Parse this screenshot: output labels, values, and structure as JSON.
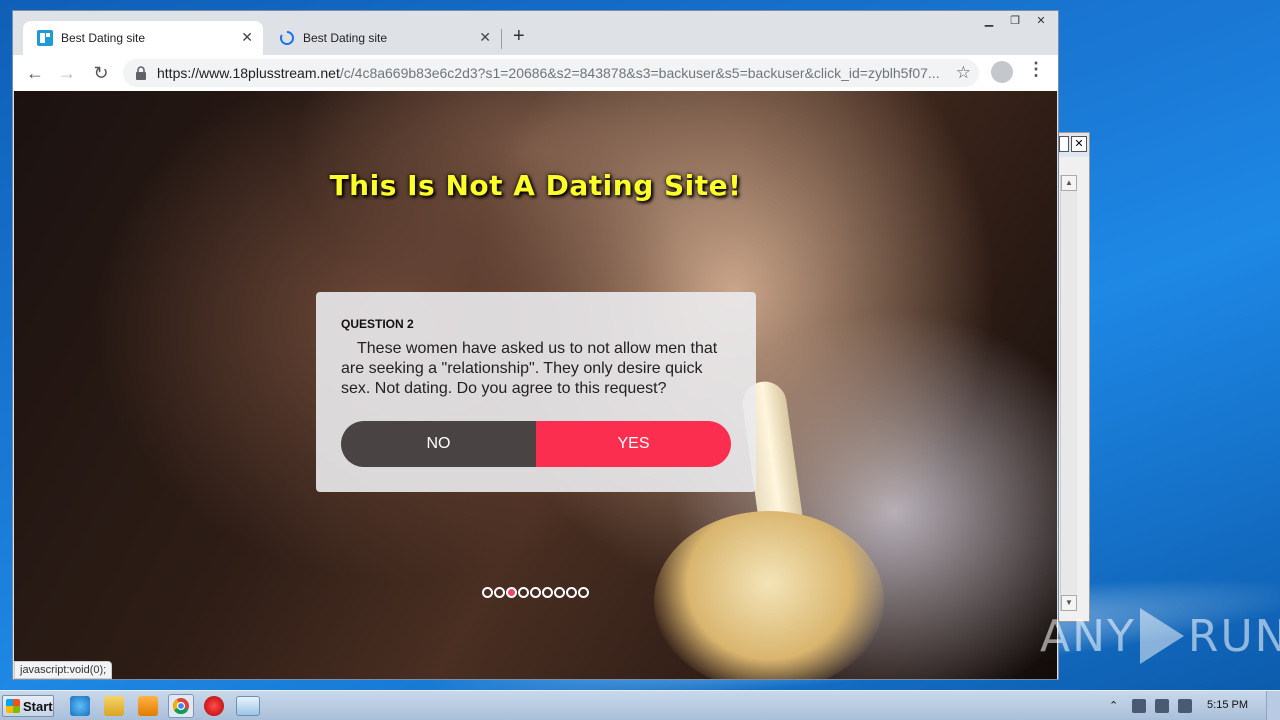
{
  "browser": {
    "tabs": [
      {
        "label": "Best Dating site",
        "active": true
      },
      {
        "label": "Best Dating site",
        "active": false
      }
    ],
    "new_tab_label": "+",
    "url_host": "https://www.18plusstream.net",
    "url_path": "/c/4c8a669b83e6c2d3?s1=20686&s2=843878&s3=backuser&s5=backuser&click_id=zyblh5f07...",
    "status_text": "javascript:void(0);"
  },
  "page": {
    "headline": "This Is Not A Dating Site!",
    "question_label": "QUESTION 2",
    "question_text": "These women have asked us to not allow men that are seeking a \"relationship\". They only desire quick sex. Not dating. Do you agree to this request?",
    "no_label": "NO",
    "yes_label": "YES",
    "progress": {
      "total": 9,
      "current": 3
    }
  },
  "colors": {
    "headline": "#fdfd2a",
    "no_button": "#4a4344",
    "yes_button": "#fb2e4f",
    "active_dot": "#f0456e"
  },
  "taskbar": {
    "start_label": "Start",
    "clock": "5:15 PM"
  },
  "watermark": {
    "left": "ANY",
    "right": "RUN"
  }
}
